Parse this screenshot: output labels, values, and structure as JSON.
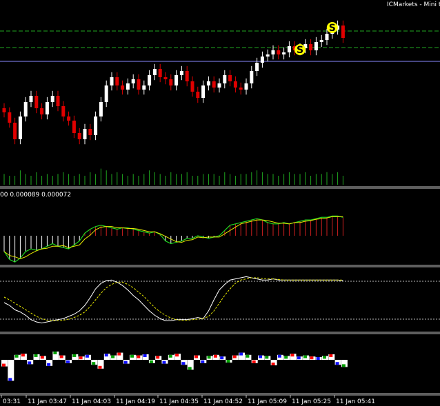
{
  "header": {
    "broker": "ICMarkets - Mini t"
  },
  "panels": {
    "macd_values": "00 0.000089 0.000072"
  },
  "signals": [
    {
      "label": "S",
      "index": 55
    },
    {
      "label": "S",
      "index": 61
    }
  ],
  "time_axis": {
    "labels": [
      "03:31",
      "11 Jan 03:47",
      "11 Jan 04:03",
      "11 Jan 04:19",
      "11 Jan 04:35",
      "11 Jan 04:52",
      "11 Jan 05:09",
      "11 Jan 05:25",
      "11 Jan 05:41"
    ]
  },
  "colors": {
    "background": "#000000",
    "bull_candle": "#ffffff",
    "bear_candle": "#e00000",
    "volume": "#1fa81f",
    "macd_signal_up": "#e8e800",
    "macd_line": "#1fd41f",
    "stoch_main": "#ffffff",
    "stoch_signal": "#e8e800",
    "level_line": "#1fa81f",
    "price_line": "#8a8aff",
    "histo_red": "#ff0000",
    "histo_blue": "#1010ff",
    "histo_green": "#00a000",
    "signal_circle": "#ffff00"
  },
  "chart_data": {
    "type": "candlestick",
    "close": [
      1.32,
      1.295,
      1.255,
      1.31,
      1.345,
      1.36,
      1.33,
      1.315,
      1.345,
      1.36,
      1.335,
      1.31,
      1.3,
      1.27,
      1.255,
      1.28,
      1.265,
      1.31,
      1.345,
      1.385,
      1.405,
      1.385,
      1.375,
      1.39,
      1.4,
      1.375,
      1.385,
      1.41,
      1.425,
      1.405,
      1.4,
      1.385,
      1.41,
      1.42,
      1.395,
      1.37,
      1.355,
      1.385,
      1.395,
      1.38,
      1.39,
      1.41,
      1.395,
      1.38,
      1.375,
      1.39,
      1.42,
      1.44,
      1.455,
      1.46,
      1.47,
      1.46,
      1.465,
      1.48,
      1.47,
      1.475,
      1.485,
      1.47,
      1.49,
      1.495,
      1.51,
      1.52,
      1.53,
      1.5
    ],
    "volume": [
      6,
      5,
      5,
      8,
      6,
      5,
      7,
      5,
      6,
      5,
      6,
      7,
      6,
      5,
      6,
      5,
      7,
      6,
      9,
      8,
      6,
      7,
      6,
      5,
      6,
      5,
      6,
      8,
      7,
      6,
      5,
      7,
      6,
      6,
      7,
      5,
      5,
      6,
      6,
      6,
      5,
      7,
      6,
      5,
      6,
      6,
      7,
      8,
      7,
      6,
      6,
      5,
      6,
      7,
      6,
      6,
      7,
      5,
      6,
      6,
      7,
      6,
      7,
      5
    ],
    "macd": [
      -0.00012,
      -0.00018,
      -0.0002,
      -0.00017,
      -0.00012,
      -0.0001,
      -0.00011,
      -0.0001,
      -8e-05,
      -6e-05,
      -8e-05,
      -9e-05,
      -0.0001,
      -7e-05,
      -4e-05,
      2e-05,
      5e-05,
      7e-05,
      8e-05,
      7e-05,
      6e-05,
      5e-05,
      6e-05,
      6e-05,
      5e-05,
      4e-05,
      3e-05,
      2e-05,
      3e-05,
      1e-05,
      -4e-05,
      -6e-05,
      -5e-05,
      -4e-05,
      -2e-05,
      -2e-05,
      0.0,
      -1e-05,
      -2e-05,
      -1e-05,
      0.0,
      4e-05,
      8e-05,
      9e-05,
      0.0001,
      0.00011,
      0.00012,
      0.00013,
      0.00012,
      0.0001,
      9e-05,
      9e-05,
      0.0001,
      9e-05,
      0.0001,
      0.00011,
      0.00012,
      0.00012,
      0.00013,
      0.00014,
      0.00014,
      0.00015,
      0.00015,
      0.00014
    ],
    "stoch_main": [
      45,
      40,
      32,
      28,
      22,
      14,
      10,
      8,
      10,
      12,
      14,
      16,
      20,
      24,
      30,
      40,
      54,
      70,
      80,
      85,
      86,
      82,
      76,
      68,
      58,
      50,
      40,
      30,
      22,
      16,
      12,
      12,
      14,
      14,
      14,
      16,
      18,
      16,
      30,
      50,
      68,
      78,
      86,
      88,
      90,
      92,
      90,
      88,
      86,
      86,
      88,
      86,
      86,
      86,
      86,
      86,
      86,
      86,
      86,
      86,
      86,
      86,
      86,
      85
    ],
    "stoch_signal": [
      55,
      50,
      44,
      38,
      32,
      26,
      20,
      16,
      13,
      12,
      12,
      13,
      15,
      18,
      22,
      28,
      38,
      50,
      62,
      72,
      78,
      82,
      82,
      78,
      72,
      64,
      56,
      46,
      36,
      28,
      22,
      17,
      14,
      13,
      13,
      14,
      15,
      16,
      20,
      30,
      44,
      58,
      70,
      80,
      86,
      88,
      90,
      90,
      89,
      88,
      88,
      87,
      86,
      86,
      86,
      86,
      86,
      86,
      86,
      86,
      86,
      86,
      86,
      86
    ],
    "histogram": [
      -1.2,
      -3.8,
      0.9,
      1.1,
      -0.8,
      1.0,
      0.7,
      -1.1,
      1.5,
      0.8,
      -0.6,
      1.0,
      0.6,
      0.9,
      -0.9,
      -1.6,
      1.1,
      0.8,
      1.3,
      -0.7,
      0.9,
      0.8,
      1.0,
      -0.6,
      0.7,
      -0.7,
      0.9,
      1.1,
      -0.9,
      -1.8,
      0.8,
      -0.6,
      0.7,
      0.9,
      0.6,
      -0.5,
      0.8,
      1.3,
      0.9,
      -0.6,
      0.8,
      0.7,
      -1.0,
      0.9,
      0.7,
      1.1,
      0.6,
      0.8,
      0.6,
      0.5,
      0.7,
      1.0,
      -0.9,
      -1.3
    ]
  }
}
